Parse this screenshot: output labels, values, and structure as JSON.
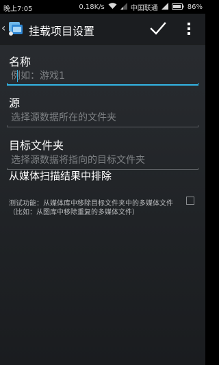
{
  "status_bar": {
    "time": "晚上7:05",
    "network_speed": "0.18K/s",
    "carrier": "中国联通",
    "battery": "86%"
  },
  "action_bar": {
    "title": "挂载项目设置",
    "back_icon": "chevron-left-icon",
    "app_icon": "app-icon",
    "confirm_icon": "checkmark-icon",
    "overflow_icon": "overflow-menu-icon"
  },
  "form": {
    "name": {
      "label": "名称",
      "value": "",
      "placeholder": "例如：游戏1"
    },
    "source": {
      "label": "源",
      "value": "",
      "placeholder": "选择源数据所在的文件夹"
    },
    "target": {
      "label": "目标文件夹",
      "value": "",
      "placeholder": "选择源数据将指向的目标文件夹"
    },
    "exclude_media": {
      "title": "从媒体扫描结果中排除",
      "description": "测试功能：从媒体库中移除目标文件夹中的多媒体文件（比如：从图库中移除重复的多媒体文件）",
      "checked": false
    }
  },
  "colors": {
    "accent": "#33b5e5",
    "background": "#26292d",
    "text_primary": "#ffffff",
    "text_hint": "#7e8184"
  }
}
